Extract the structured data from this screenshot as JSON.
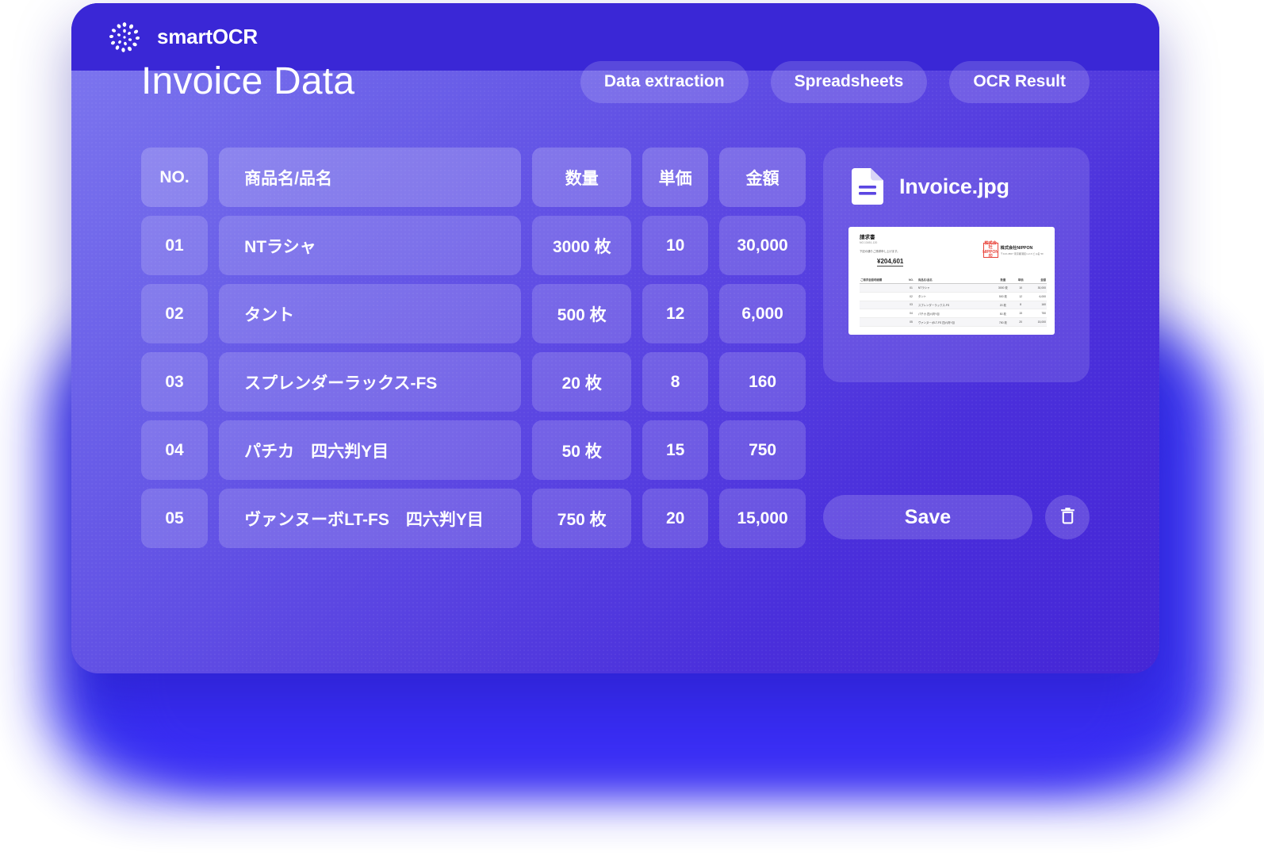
{
  "brand": {
    "name": "smartOCR",
    "logo_icon": "dot-burst-logo-icon"
  },
  "header": {
    "title": "Invoice Data",
    "tabs": [
      {
        "label": "Data extraction"
      },
      {
        "label": "Spreadsheets"
      },
      {
        "label": "OCR Result"
      }
    ]
  },
  "table": {
    "columns": [
      "NO.",
      "商品名/品名",
      "数量",
      "単価",
      "金額"
    ],
    "rows": [
      {
        "no": "01",
        "name": "NTラシャ",
        "qty": "3000 枚",
        "price": "10",
        "amount": "30,000"
      },
      {
        "no": "02",
        "name": "タント",
        "qty": "500 枚",
        "price": "12",
        "amount": "6,000"
      },
      {
        "no": "03",
        "name": "スプレンダーラックス-FS",
        "qty": "20 枚",
        "price": "8",
        "amount": "160"
      },
      {
        "no": "04",
        "name": "パチカ　四六判Y目",
        "qty": "50 枚",
        "price": "15",
        "amount": "750"
      },
      {
        "no": "05",
        "name": "ヴァンヌーボLT-FS　四六判Y目",
        "qty": "750 枚",
        "price": "20",
        "amount": "15,000"
      }
    ]
  },
  "file_panel": {
    "file_name": "Invoice.jpg",
    "file_icon": "document-icon",
    "preview": {
      "doc_title": "請求書",
      "doc_no": "NO.13451-120",
      "lead_text": "下記の通りご請求申し上げます。",
      "total": "¥204,601",
      "seal_text": "株式会社NIPPON印",
      "company": "株式会社NIPPON",
      "company_sub": "〒123-4567 東京都港区1-2-3 ビル名 5F",
      "left_label": "ご請求金額明細欄",
      "columns": [
        "NO.",
        "商品名/品名",
        "数量",
        "単価",
        "金額"
      ],
      "rows": [
        {
          "no": "01",
          "name": "NTラシャ",
          "qty": "3000 枚",
          "price": "10",
          "amount": "30,000"
        },
        {
          "no": "02",
          "name": "タント",
          "qty": "500 枚",
          "price": "12",
          "amount": "6,000"
        },
        {
          "no": "03",
          "name": "スプレンダーラックス-FS",
          "qty": "20 枚",
          "price": "8",
          "amount": "160"
        },
        {
          "no": "04",
          "name": "パチカ 四六判Y目",
          "qty": "50 枚",
          "price": "15",
          "amount": "750"
        },
        {
          "no": "05",
          "name": "ヴァンヌーボLT-FS 四六判Y目",
          "qty": "750 枚",
          "price": "20",
          "amount": "15,000"
        }
      ]
    }
  },
  "actions": {
    "save_label": "Save",
    "delete_icon": "trash-icon"
  },
  "colors": {
    "brand_bar": "#3A27D6",
    "panel_gradient_start": "#7B74EE",
    "panel_gradient_end": "#4526D6",
    "glow": "#2821F0",
    "text_on_dark": "#FFFFFF",
    "seal_red": "#E8443A"
  }
}
